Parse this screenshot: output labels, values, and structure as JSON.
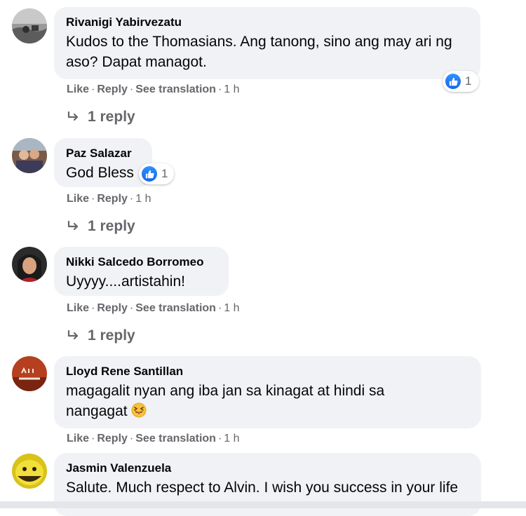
{
  "comments": [
    {
      "author": "Rivanigi Yabirvezatu",
      "text": "Kudos to the Thomasians. Ang tanong, sino ang may ari ng aso? Dapat managot.",
      "reaction_count": "1",
      "like": "Like",
      "reply": "Reply",
      "translate": "See translation",
      "time": "1 h",
      "replies": "1 reply"
    },
    {
      "author": "Paz Salazar",
      "text": "God Bless",
      "reaction_count": "1",
      "like": "Like",
      "reply": "Reply",
      "time": "1 h",
      "replies": "1 reply"
    },
    {
      "author": "Nikki Salcedo Borromeo",
      "text": "Uyyyy....artistahin!",
      "like": "Like",
      "reply": "Reply",
      "translate": "See translation",
      "time": "1 h",
      "replies": "1 reply"
    },
    {
      "author": "Lloyd Rene Santillan",
      "text": "magagalit nyan ang iba jan sa kinagat at hindi sa nangagat",
      "emoji": "squinting-face-with-tongue-emoji",
      "like": "Like",
      "reply": "Reply",
      "translate": "See translation",
      "time": "1 h"
    },
    {
      "author": "Jasmin Valenzuela",
      "text": "Salute. Much respect to Alvin. I wish you success in your life"
    }
  ],
  "colors": {
    "bubble": "#f0f2f5",
    "meta_text": "#65676b",
    "like_blue": "#1877f2"
  },
  "icons": {
    "reaction": "like-reaction-icon",
    "reply_arrow": "reply-arrow-icon"
  }
}
